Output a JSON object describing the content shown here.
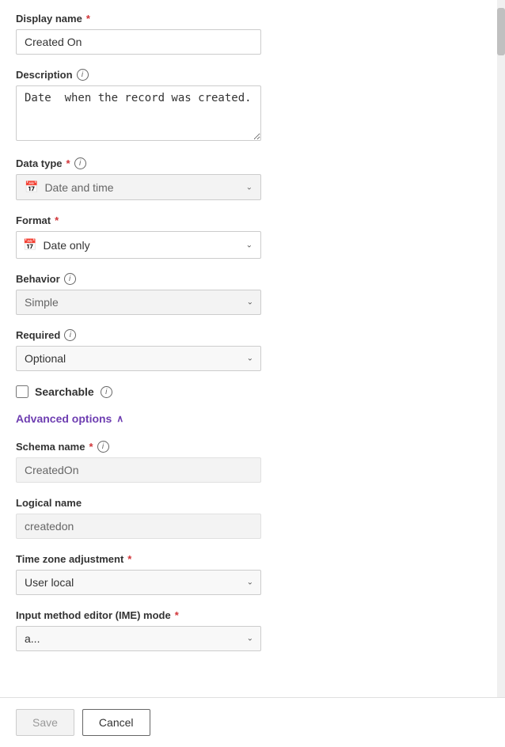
{
  "form": {
    "display_name_label": "Display name",
    "display_name_value": "Created On",
    "description_label": "Description",
    "description_value": "Date  when the record was created.",
    "data_type_label": "Data type",
    "data_type_value": "Date and time",
    "format_label": "Format",
    "format_value": "Date only",
    "behavior_label": "Behavior",
    "behavior_value": "Simple",
    "required_label": "Required",
    "required_value": "Optional",
    "searchable_label": "Searchable",
    "advanced_options_label": "Advanced options",
    "schema_name_label": "Schema name",
    "schema_name_value": "CreatedOn",
    "logical_name_label": "Logical name",
    "logical_name_value": "createdon",
    "time_zone_label": "Time zone adjustment",
    "time_zone_value": "User local",
    "ime_mode_label": "Input method editor (IME) mode",
    "ime_mode_value": "a...",
    "save_label": "Save",
    "cancel_label": "Cancel"
  },
  "icons": {
    "info": "i",
    "calendar": "📅",
    "chevron_down": "⌄",
    "chevron_up": "∧"
  }
}
